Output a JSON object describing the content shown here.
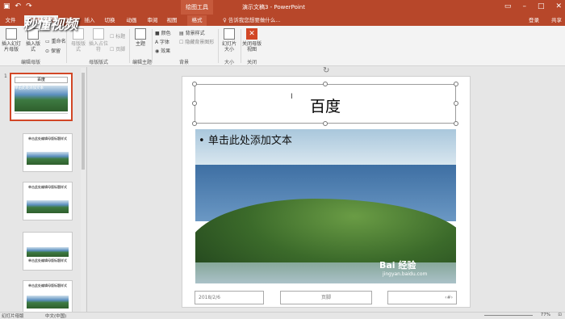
{
  "title_bar": {
    "context_title": "绘图工具",
    "doc_title": "演示文稿3 - PowerPoint",
    "qat_icons": [
      "save-icon",
      "undo-icon",
      "redo-icon"
    ]
  },
  "tabs": [
    {
      "label": "文件"
    },
    {
      "label": "幻灯片母版",
      "active": true
    },
    {
      "label": "开始"
    },
    {
      "label": "插入"
    },
    {
      "label": "切换"
    },
    {
      "label": "动画"
    },
    {
      "label": "审阅"
    },
    {
      "label": "视图"
    },
    {
      "label": "格式",
      "context": true
    }
  ],
  "tell_me": "告诉我您想要做什么...",
  "account": {
    "login": "登录",
    "share": "共享"
  },
  "ribbon": {
    "insert_slide_master": "插入幻灯片母版",
    "insert_layout": "插入版式",
    "rename": "重命名",
    "preserve": "保留",
    "master_layout": "母版版式",
    "insert_placeholder": "插入占位符",
    "title": "标题",
    "footer": "页脚",
    "theme": "主题",
    "colors": "颜色",
    "fonts": "字体",
    "effects": "效果",
    "bg_styles": "背景样式",
    "hide_bg": "隐藏背景图形",
    "slide_size": "幻灯片大小",
    "close_master": "关闭母版视图",
    "groups": [
      "编辑母版",
      "母版版式",
      "编辑主题",
      "背景",
      "大小",
      "关闭"
    ]
  },
  "watermark": "秒懂视频",
  "slide_panel": {
    "thumbs": [
      {
        "num": "1",
        "title": "百度",
        "bullet": "单击此处添加文本",
        "selected": true
      },
      {
        "num": "",
        "title": "单击此处编辑母版标题样式"
      },
      {
        "num": "",
        "title": "单击此处编辑母版标题样式"
      },
      {
        "num": "",
        "title": "单击此处编辑母版标题样式"
      },
      {
        "num": "",
        "title": "单击此处编辑母版标题样式"
      }
    ]
  },
  "slide": {
    "title": "百度",
    "bullet": "单击此处添加文本",
    "image_watermark": "Bai 经验",
    "image_watermark_url": "jingyan.baidu.com",
    "footer_date": "2018/2/6",
    "footer_center": "页脚",
    "footer_num": "‹#›"
  },
  "status_bar": {
    "view": "幻灯片母版",
    "language": "中文(中国)",
    "zoom": "77%"
  }
}
